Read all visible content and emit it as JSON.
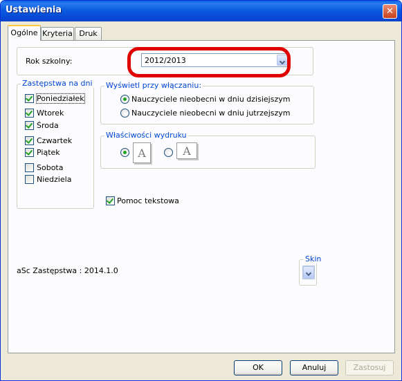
{
  "window": {
    "title": "Ustawienia",
    "close_glyph": "✕"
  },
  "tabs": [
    {
      "label": "Ogólne",
      "active": true
    },
    {
      "label": "Kryteria",
      "active": false
    },
    {
      "label": "Druk",
      "active": false
    }
  ],
  "school_year": {
    "label": "Rok szkolny:",
    "value": "2012/2013"
  },
  "days": {
    "legend": "Zastępstwa na dni",
    "items": [
      {
        "label": "Poniedziałek",
        "checked": true
      },
      {
        "label": "Wtorek",
        "checked": true
      },
      {
        "label": "Środa",
        "checked": true
      },
      {
        "label": "Czwartek",
        "checked": true
      },
      {
        "label": "Piątek",
        "checked": true
      },
      {
        "label": "Sobota",
        "checked": false
      },
      {
        "label": "Niedziela",
        "checked": false
      }
    ]
  },
  "startup": {
    "legend": "Wyświetl przy włączaniu:",
    "options": [
      {
        "label": "Nauczyciele nieobecni w dniu dzisiejszym",
        "selected": true
      },
      {
        "label": "Nauczyciele nieobecni w dniu jutrzejszym",
        "selected": false
      }
    ]
  },
  "print": {
    "legend": "Właściwości wydruku",
    "options": [
      {
        "icon": "portrait-page-icon",
        "glyph": "A",
        "selected": true
      },
      {
        "icon": "landscape-page-icon",
        "glyph": "A",
        "selected": false
      }
    ]
  },
  "help_text": {
    "label": "Pomoc tekstowa",
    "checked": true
  },
  "version": "aSc Zastępstwa : 2014.1.0",
  "skin": {
    "legend": "Skin"
  },
  "buttons": {
    "ok": "OK",
    "cancel": "Anuluj",
    "apply": "Zastosuj"
  },
  "colors": {
    "title_bar": "#0a5fe5",
    "legend_text": "#0046d5",
    "highlight": "#e00000",
    "check": "#21a121"
  }
}
